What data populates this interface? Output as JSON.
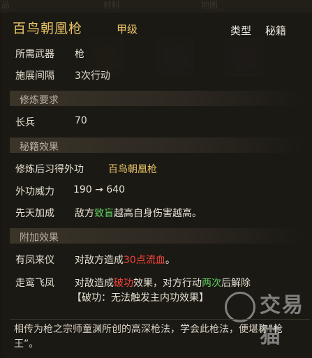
{
  "background": {
    "tabs": [
      "品",
      "材料",
      "地图"
    ]
  },
  "header": {
    "title": "百鸟朝凰枪",
    "grade": "甲级",
    "type_label": "类型",
    "type_value": "秘籍"
  },
  "basic": {
    "weapon_label": "所需武器",
    "weapon_value": "枪",
    "interval_label": "施展间隔",
    "interval_value": "3次行动"
  },
  "sections": {
    "cultivation_req": "修炼要求",
    "secret_effect": "秘籍效果",
    "extra_effect": "附加效果"
  },
  "requirements": {
    "stat_label": "长兵",
    "stat_value": "70"
  },
  "effects": {
    "learn_label": "修炼后习得外功",
    "learn_value": "百鸟朝凰枪",
    "power_label": "外功威力",
    "power_value": "190 → 640",
    "innate_label": "先天加成",
    "innate_pre": "敌方",
    "innate_highlight": "致盲",
    "innate_post": "越高自身伤害越高。"
  },
  "extras": {
    "e1_label": "有凤来仪",
    "e1_pre": "对敌方造成",
    "e1_highlight": "30点流血",
    "e1_post": "。",
    "e2_label": "走鸾飞凤",
    "e2_pre": "对敌造成",
    "e2_highlight": "破功",
    "e2_mid": "效果，对方行动",
    "e2_highlight2": "两次",
    "e2_post": "后解除",
    "e2_line2": "【破功：无法触发主内功效果】"
  },
  "description": "相传为枪之宗师童渊所创的高深枪法，学会此枪法，便堪称“枪王”。",
  "watermark": "交易猫"
}
